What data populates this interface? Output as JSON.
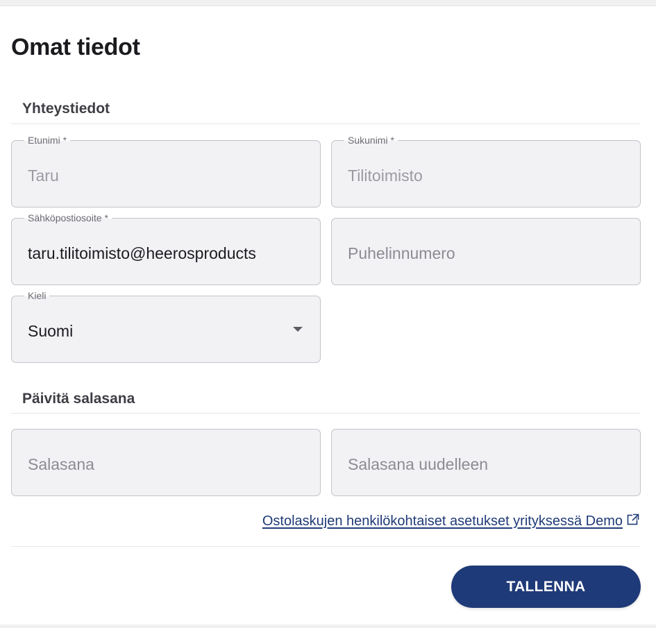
{
  "page": {
    "title": "Omat tiedot"
  },
  "contact_section": {
    "title": "Yhteystiedot",
    "first_name": {
      "label": "Etunimi *",
      "value": "Taru"
    },
    "last_name": {
      "label": "Sukunimi *",
      "value": "Tilitoimisto"
    },
    "email": {
      "label": "Sähköpostiosoite *",
      "value": "taru.tilitoimisto@heerosproducts"
    },
    "phone": {
      "placeholder": "Puhelinnumero"
    },
    "language": {
      "label": "Kieli",
      "value": "Suomi"
    }
  },
  "password_section": {
    "title": "Päivitä salasana",
    "password": {
      "placeholder": "Salasana"
    },
    "password_repeat": {
      "placeholder": "Salasana uudelleen"
    }
  },
  "invoice_settings_link": {
    "text": "Ostolaskujen henkilökohtaiset asetukset yrityksessä Demo",
    "icon": "external-link-icon"
  },
  "actions": {
    "save_label": "TALLENNA"
  },
  "colors": {
    "accent": "#1f3a78",
    "field_background": "#f2f2f5",
    "field_border": "#c3c3c9"
  }
}
